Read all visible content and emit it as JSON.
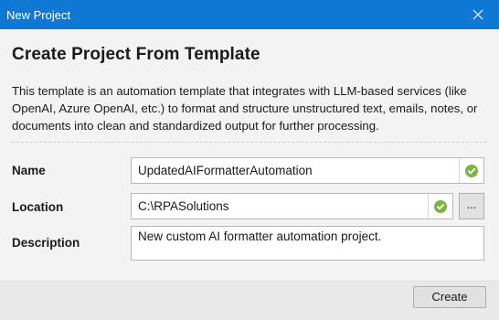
{
  "window": {
    "title": "New Project",
    "close_icon": "close-icon"
  },
  "dialog": {
    "heading": "Create Project From Template",
    "description": "This template is an automation template that integrates with LLM-based services (like OpenAI, Azure OpenAI, etc.) to format and structure unstructured text, emails, notes, or documents into clean and standardized output for further processing."
  },
  "form": {
    "name_label": "Name",
    "name_value": "UpdatedAIFormatterAutomation",
    "location_label": "Location",
    "location_value": "C:\\RPASolutions",
    "browse_label": "...",
    "description_label": "Description",
    "description_value": "New custom AI formatter automation project.",
    "valid_icon": "check-circle-icon",
    "valid_color": "#7cb342"
  },
  "footer": {
    "create_label": "Create"
  },
  "colors": {
    "titlebar": "#0f78d4",
    "background": "#f3f3f3"
  }
}
